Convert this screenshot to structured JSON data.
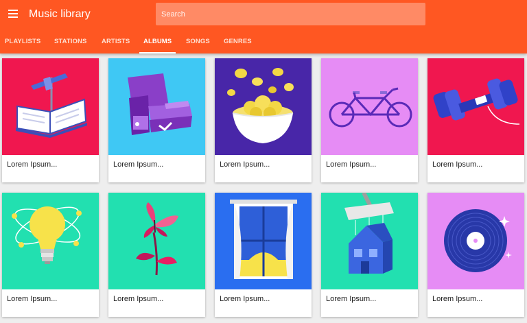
{
  "app": {
    "title": "Music library"
  },
  "search": {
    "placeholder": "Search"
  },
  "tabs": [
    {
      "label": "PLAYLISTS"
    },
    {
      "label": "STATIONS"
    },
    {
      "label": "ARTISTS"
    },
    {
      "label": "ALBUMS",
      "active": true
    },
    {
      "label": "SONGS"
    },
    {
      "label": "GENRES"
    }
  ],
  "albums": [
    {
      "title": "Lorem Ipsum...",
      "icon": "open-book-signpost-icon",
      "bg": "#f0174f"
    },
    {
      "title": "Lorem Ipsum...",
      "icon": "recliner-chair-icon",
      "bg": "#3fc8f4"
    },
    {
      "title": "Lorem Ipsum...",
      "icon": "chips-bowl-icon",
      "bg": "#4826a8"
    },
    {
      "title": "Lorem Ipsum...",
      "icon": "tandem-bicycle-icon",
      "bg": "#e68cf5"
    },
    {
      "title": "Lorem Ipsum...",
      "icon": "dumbbell-icon",
      "bg": "#f0174f"
    },
    {
      "title": "Lorem Ipsum...",
      "icon": "lightbulb-icon",
      "bg": "#22e0b0"
    },
    {
      "title": "Lorem Ipsum...",
      "icon": "butterfly-flower-icon",
      "bg": "#22e0b0"
    },
    {
      "title": "Lorem Ipsum...",
      "icon": "window-sunrise-icon",
      "bg": "#2a6ef0"
    },
    {
      "title": "Lorem Ipsum...",
      "icon": "vacuum-house-icon",
      "bg": "#22e0b0"
    },
    {
      "title": "Lorem Ipsum...",
      "icon": "vinyl-record-icon",
      "bg": "#e68cf5"
    }
  ],
  "colors": {
    "appbar": "#ff5722",
    "search_bg": "#ff8a65"
  }
}
